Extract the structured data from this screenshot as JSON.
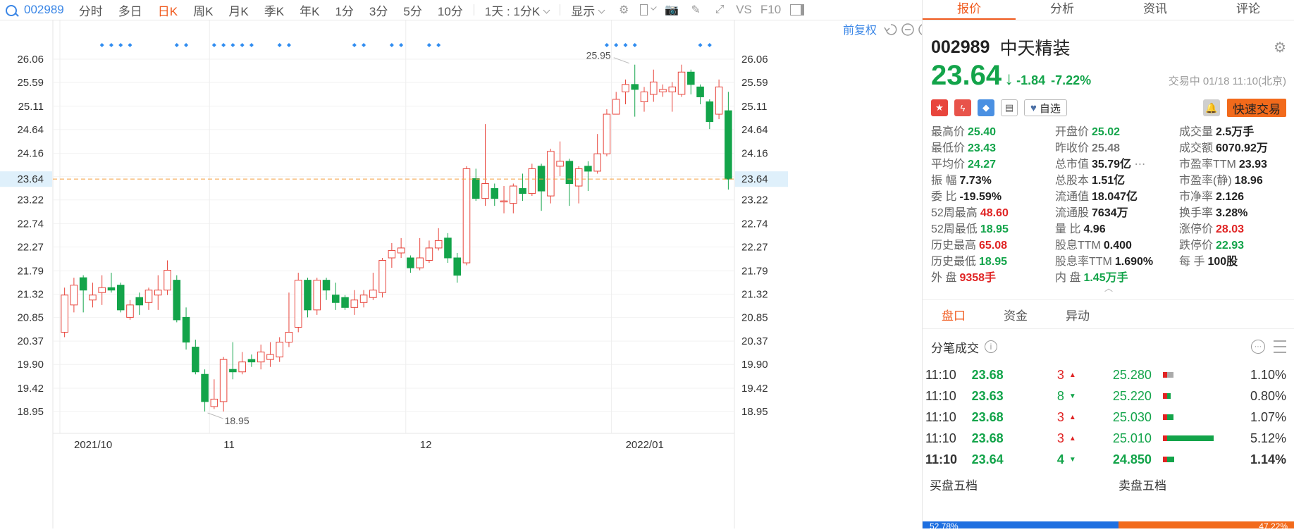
{
  "toolbar": {
    "code": "002989",
    "periods": [
      "分时",
      "多日",
      "日K",
      "周K",
      "月K",
      "季K",
      "年K",
      "1分",
      "3分",
      "5分",
      "10分"
    ],
    "active_period": "日K",
    "interval": "1天 : 1分K",
    "display": "显示",
    "vs": "VS",
    "f10": "F10"
  },
  "chart": {
    "fuquan": "前复权",
    "price_labels": [
      "26.06",
      "25.59",
      "25.11",
      "24.64",
      "24.16",
      "23.69",
      "23.22",
      "22.74",
      "22.27",
      "21.79",
      "21.32",
      "20.85",
      "20.37",
      "19.90",
      "19.42",
      "18.95"
    ],
    "current_price_label": "23.64",
    "date_labels": [
      "2021/10",
      "11",
      "12",
      "2022/01"
    ],
    "high_marker": "25.95",
    "low_marker": "18.95"
  },
  "chart_data": {
    "type": "candlestick",
    "current": 23.64,
    "ylim": [
      18.95,
      26.06
    ],
    "month_starts": [
      {
        "label": "2021/10",
        "index": 0
      },
      {
        "label": "11",
        "index": 16
      },
      {
        "label": "12",
        "index": 37
      },
      {
        "label": "2022/01",
        "index": 59
      }
    ],
    "candles": [
      {
        "o": 20.55,
        "c": 21.3,
        "h": 21.45,
        "l": 20.45
      },
      {
        "o": 21.1,
        "c": 21.5,
        "h": 21.65,
        "l": 20.95
      },
      {
        "o": 21.65,
        "c": 21.4,
        "h": 21.7,
        "l": 20.95
      },
      {
        "o": 21.2,
        "c": 21.3,
        "h": 21.55,
        "l": 21.05
      },
      {
        "o": 21.35,
        "c": 21.45,
        "h": 21.7,
        "l": 21.1
      },
      {
        "o": 21.45,
        "c": 21.4,
        "h": 21.75,
        "l": 21.35
      },
      {
        "o": 21.5,
        "c": 21.0,
        "h": 21.55,
        "l": 20.95
      },
      {
        "o": 20.85,
        "c": 21.1,
        "h": 21.2,
        "l": 20.8
      },
      {
        "o": 21.25,
        "c": 21.1,
        "h": 21.35,
        "l": 20.9
      },
      {
        "o": 21.15,
        "c": 21.4,
        "h": 21.45,
        "l": 21.0
      },
      {
        "o": 21.3,
        "c": 21.4,
        "h": 21.7,
        "l": 21.0
      },
      {
        "o": 21.4,
        "c": 21.8,
        "h": 22.0,
        "l": 21.3
      },
      {
        "o": 21.6,
        "c": 20.8,
        "h": 21.7,
        "l": 20.75
      },
      {
        "o": 20.85,
        "c": 20.35,
        "h": 21.05,
        "l": 20.2
      },
      {
        "o": 20.25,
        "c": 19.75,
        "h": 20.4,
        "l": 19.7
      },
      {
        "o": 19.7,
        "c": 19.15,
        "h": 19.8,
        "l": 18.95
      },
      {
        "o": 19.05,
        "c": 19.2,
        "h": 19.6,
        "l": 19.0
      },
      {
        "o": 19.15,
        "c": 20.0,
        "h": 20.05,
        "l": 18.95
      },
      {
        "o": 19.8,
        "c": 19.75,
        "h": 20.35,
        "l": 19.6
      },
      {
        "o": 19.75,
        "c": 19.95,
        "h": 20.15,
        "l": 19.7
      },
      {
        "o": 20.0,
        "c": 19.95,
        "h": 20.1,
        "l": 19.85
      },
      {
        "o": 19.95,
        "c": 20.15,
        "h": 20.3,
        "l": 19.8
      },
      {
        "o": 20.0,
        "c": 20.1,
        "h": 20.35,
        "l": 19.85
      },
      {
        "o": 20.05,
        "c": 20.35,
        "h": 20.45,
        "l": 19.95
      },
      {
        "o": 20.35,
        "c": 20.55,
        "h": 21.35,
        "l": 20.25
      },
      {
        "o": 20.65,
        "c": 21.6,
        "h": 21.75,
        "l": 20.55
      },
      {
        "o": 21.6,
        "c": 21.0,
        "h": 21.65,
        "l": 20.85
      },
      {
        "o": 21.0,
        "c": 21.6,
        "h": 21.65,
        "l": 20.9
      },
      {
        "o": 21.6,
        "c": 21.4,
        "h": 21.65,
        "l": 21.2
      },
      {
        "o": 21.3,
        "c": 21.15,
        "h": 21.55,
        "l": 21.0
      },
      {
        "o": 21.25,
        "c": 21.05,
        "h": 21.3,
        "l": 21.0
      },
      {
        "o": 21.05,
        "c": 21.2,
        "h": 21.4,
        "l": 20.9
      },
      {
        "o": 21.15,
        "c": 21.3,
        "h": 21.4,
        "l": 21.05
      },
      {
        "o": 21.25,
        "c": 21.4,
        "h": 21.75,
        "l": 21.2
      },
      {
        "o": 21.35,
        "c": 22.0,
        "h": 22.05,
        "l": 21.25
      },
      {
        "o": 22.05,
        "c": 22.2,
        "h": 22.35,
        "l": 21.85
      },
      {
        "o": 22.15,
        "c": 22.25,
        "h": 22.45,
        "l": 22.05
      },
      {
        "o": 22.05,
        "c": 21.85,
        "h": 22.1,
        "l": 21.75
      },
      {
        "o": 21.85,
        "c": 22.05,
        "h": 22.45,
        "l": 21.8
      },
      {
        "o": 22.0,
        "c": 22.25,
        "h": 22.4,
        "l": 21.95
      },
      {
        "o": 22.25,
        "c": 22.4,
        "h": 22.65,
        "l": 22.2
      },
      {
        "o": 22.45,
        "c": 22.05,
        "h": 22.55,
        "l": 21.95
      },
      {
        "o": 22.05,
        "c": 21.7,
        "h": 22.15,
        "l": 21.55
      },
      {
        "o": 21.95,
        "c": 23.85,
        "h": 23.9,
        "l": 21.9
      },
      {
        "o": 23.65,
        "c": 23.25,
        "h": 23.85,
        "l": 23.2
      },
      {
        "o": 23.25,
        "c": 23.55,
        "h": 24.75,
        "l": 23.1
      },
      {
        "o": 23.45,
        "c": 23.25,
        "h": 23.55,
        "l": 23.1
      },
      {
        "o": 23.2,
        "c": 23.2,
        "h": 23.5,
        "l": 22.95
      },
      {
        "o": 23.15,
        "c": 23.5,
        "h": 23.55,
        "l": 22.95
      },
      {
        "o": 23.45,
        "c": 23.35,
        "h": 23.75,
        "l": 23.2
      },
      {
        "o": 23.35,
        "c": 23.85,
        "h": 23.95,
        "l": 23.3
      },
      {
        "o": 23.9,
        "c": 23.4,
        "h": 23.95,
        "l": 23.0
      },
      {
        "o": 23.3,
        "c": 24.2,
        "h": 24.25,
        "l": 23.15
      },
      {
        "o": 23.9,
        "c": 24.0,
        "h": 24.4,
        "l": 23.7
      },
      {
        "o": 24.0,
        "c": 23.55,
        "h": 24.05,
        "l": 23.1
      },
      {
        "o": 23.5,
        "c": 23.85,
        "h": 23.9,
        "l": 23.15
      },
      {
        "o": 23.9,
        "c": 23.8,
        "h": 24.0,
        "l": 23.4
      },
      {
        "o": 23.8,
        "c": 24.15,
        "h": 24.55,
        "l": 23.75
      },
      {
        "o": 24.15,
        "c": 24.95,
        "h": 25.05,
        "l": 24.1
      },
      {
        "o": 24.95,
        "c": 25.25,
        "h": 25.4,
        "l": 24.95
      },
      {
        "o": 25.4,
        "c": 25.55,
        "h": 25.65,
        "l": 25.15
      },
      {
        "o": 25.55,
        "c": 25.45,
        "h": 25.95,
        "l": 24.9
      },
      {
        "o": 25.2,
        "c": 25.4,
        "h": 25.5,
        "l": 25.0
      },
      {
        "o": 25.35,
        "c": 25.6,
        "h": 25.85,
        "l": 25.2
      },
      {
        "o": 25.4,
        "c": 25.45,
        "h": 25.55,
        "l": 25.3
      },
      {
        "o": 25.4,
        "c": 25.5,
        "h": 25.6,
        "l": 25.0
      },
      {
        "o": 25.35,
        "c": 25.8,
        "h": 25.95,
        "l": 25.3
      },
      {
        "o": 25.8,
        "c": 25.55,
        "h": 25.85,
        "l": 25.35
      },
      {
        "o": 25.5,
        "c": 25.3,
        "h": 25.55,
        "l": 25.15
      },
      {
        "o": 25.2,
        "c": 24.8,
        "h": 25.25,
        "l": 24.65
      },
      {
        "o": 24.95,
        "c": 25.5,
        "h": 25.65,
        "l": 24.85
      },
      {
        "o": 25.02,
        "c": 23.64,
        "h": 25.4,
        "l": 23.43
      }
    ],
    "diamond_groups": [
      [
        4,
        7
      ],
      [
        12,
        13
      ],
      [
        16,
        20
      ],
      [
        23,
        24
      ],
      [
        31,
        32
      ],
      [
        35,
        36
      ],
      [
        39,
        40
      ],
      [
        58,
        61
      ],
      [
        68,
        69
      ]
    ]
  },
  "quote": {
    "tabs": [
      "报价",
      "分析",
      "资讯",
      "评论"
    ],
    "code": "002989",
    "name": "中天精装",
    "price": "23.64",
    "change": "-1.84",
    "change_pct": "-7.22%",
    "trade_info": "交易中 01/18 11:10(北京)",
    "watch_label": "自选",
    "fast_trade": "快速交易",
    "stats": [
      {
        "label": "最高价",
        "value": "25.40",
        "color": "green"
      },
      {
        "label": "开盘价",
        "value": "25.02",
        "color": "green"
      },
      {
        "label": "成交量",
        "value": "2.5万手",
        "color": ""
      },
      {
        "label": "最低价",
        "value": "23.43",
        "color": "green"
      },
      {
        "label": "昨收价",
        "value": "25.48",
        "color": "gray"
      },
      {
        "label": "成交额",
        "value": "6070.92万",
        "color": ""
      },
      {
        "label": "平均价",
        "value": "24.27",
        "color": "green"
      },
      {
        "label": "总市值",
        "value": "35.79亿",
        "color": ""
      },
      {
        "label": "市盈率TTM",
        "value": "23.93",
        "color": ""
      },
      {
        "label": "振    幅",
        "value": "7.73%",
        "color": ""
      },
      {
        "label": "总股本",
        "value": "1.51亿",
        "color": ""
      },
      {
        "label": "市盈率(静)",
        "value": "18.96",
        "color": ""
      },
      {
        "label": "委    比",
        "value": "-19.59%",
        "color": ""
      },
      {
        "label": "流通值",
        "value": "18.047亿",
        "color": ""
      },
      {
        "label": "市净率",
        "value": "2.126",
        "color": ""
      },
      {
        "label": "52周最高",
        "value": "48.60",
        "color": "red"
      },
      {
        "label": "流通股",
        "value": "7634万",
        "color": ""
      },
      {
        "label": "换手率",
        "value": "3.28%",
        "color": ""
      },
      {
        "label": "52周最低",
        "value": "18.95",
        "color": "green"
      },
      {
        "label": "量    比",
        "value": "4.96",
        "color": ""
      },
      {
        "label": "涨停价",
        "value": "28.03",
        "color": "red"
      },
      {
        "label": "历史最高",
        "value": "65.08",
        "color": "red"
      },
      {
        "label": "股息TTM",
        "value": "0.400",
        "color": ""
      },
      {
        "label": "跌停价",
        "value": "22.93",
        "color": "green"
      },
      {
        "label": "历史最低",
        "value": "18.95",
        "color": "green"
      },
      {
        "label": "股息率TTM",
        "value": "1.690%",
        "color": ""
      },
      {
        "label": "每    手",
        "value": "100股",
        "color": ""
      },
      {
        "label": "外    盘",
        "value": "9358手",
        "color": "red"
      },
      {
        "label": "内    盘",
        "value": "1.45万手",
        "color": "green"
      },
      {
        "label": "",
        "value": "",
        "color": ""
      }
    ],
    "subtabs": [
      "盘口",
      "资金",
      "异动"
    ],
    "fenbi_title": "分笔成交",
    "trades": [
      {
        "time": "11:10",
        "price": "23.68",
        "vol": "3",
        "dir": "up",
        "avg": "25.280",
        "bar": 0.16,
        "barcolor": "gray",
        "pct": "1.10%"
      },
      {
        "time": "11:10",
        "price": "23.63",
        "vol": "8",
        "dir": "down",
        "avg": "25.220",
        "bar": 0.12,
        "barcolor": "green",
        "pct": "0.80%"
      },
      {
        "time": "11:10",
        "price": "23.68",
        "vol": "3",
        "dir": "up",
        "avg": "25.030",
        "bar": 0.16,
        "barcolor": "green",
        "pct": "1.07%"
      },
      {
        "time": "11:10",
        "price": "23.68",
        "vol": "3",
        "dir": "up",
        "avg": "25.010",
        "bar": 0.77,
        "barcolor": "green",
        "pct": "5.12%"
      },
      {
        "time": "11:10",
        "price": "23.64",
        "vol": "4",
        "dir": "down",
        "avg": "24.850",
        "bar": 0.17,
        "barcolor": "green",
        "pct": "1.14%"
      }
    ],
    "buy5": "买盘五档",
    "sell5": "卖盘五档",
    "buy_ratio": "52.78%",
    "sell_ratio": "47.22%"
  }
}
